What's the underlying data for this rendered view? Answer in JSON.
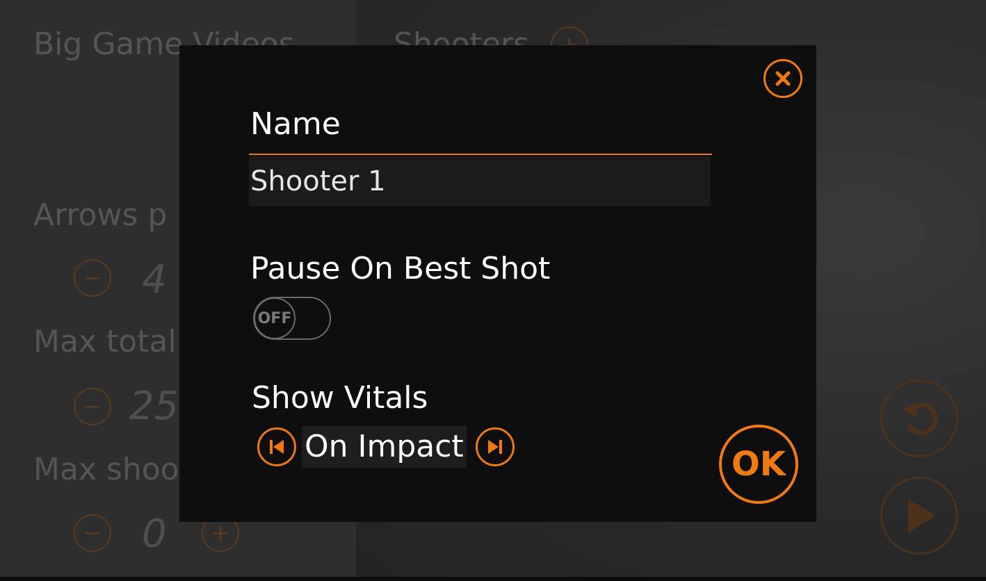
{
  "background": {
    "title": "Big Game Videos",
    "shooters_label": "Shooters",
    "arrows_label": "Arrows p",
    "arrows_value": "4",
    "max_total_label": "Max total",
    "max_total_value": "25",
    "max_shooters_label": "Max shoo",
    "max_shooters_value": "0",
    "minus_glyph": "−",
    "plus_glyph": "+"
  },
  "dialog": {
    "name_label": "Name",
    "name_value": "Shooter 1",
    "pause_label": "Pause On Best Shot",
    "pause_toggle_text": "OFF",
    "vitals_label": "Show Vitals",
    "vitals_value": "On Impact",
    "ok_label": "OK"
  },
  "colors": {
    "accent": "#f07a12",
    "modal_bg": "#0e0e0e",
    "input_bg": "#1b1b1b"
  },
  "icons": {
    "close": "close-icon",
    "prev": "skip-previous-icon",
    "next": "skip-next-icon",
    "reset": "undo-icon",
    "play": "play-icon"
  }
}
